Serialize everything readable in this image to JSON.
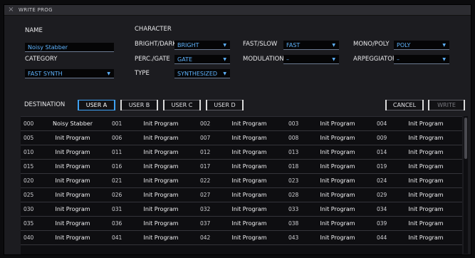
{
  "window": {
    "title": "WRITE PROG",
    "close_icon": "close-icon"
  },
  "labels": {
    "name": "NAME",
    "category": "CATEGORY",
    "character": "CHARACTER",
    "bright_dark": "BRIGHT/DARK",
    "perc_gate": "PERC./GATE",
    "type": "TYPE",
    "fast_slow": "FAST/SLOW",
    "modulation": "MODULATION",
    "mono_poly": "MONO/POLY",
    "arpeggiator": "ARPEGGIATOR",
    "destination": "DESTINATION"
  },
  "fields": {
    "name": "Noisy Stabber",
    "category": "FAST SYNTH",
    "bright_dark": "BRIGHT",
    "perc_gate": "GATE",
    "type": "SYNTHESIZED",
    "fast_slow": "FAST",
    "modulation": "–",
    "mono_poly": "POLY",
    "arpeggiator": "–",
    "dropdown_arrow": "▼"
  },
  "destination_buttons": [
    "USER A",
    "USER B",
    "USER C",
    "USER D"
  ],
  "active_destination": "USER A",
  "actions": {
    "cancel": "CANCEL",
    "write": "WRITE"
  },
  "programs": [
    [
      "000",
      "Noisy Stabber"
    ],
    [
      "001",
      "Init Program"
    ],
    [
      "002",
      "Init Program"
    ],
    [
      "003",
      "Init Program"
    ],
    [
      "004",
      "Init Program"
    ],
    [
      "005",
      "Init Program"
    ],
    [
      "006",
      "Init Program"
    ],
    [
      "007",
      "Init Program"
    ],
    [
      "008",
      "Init Program"
    ],
    [
      "009",
      "Init Program"
    ],
    [
      "010",
      "Init Program"
    ],
    [
      "011",
      "Init Program"
    ],
    [
      "012",
      "Init Program"
    ],
    [
      "013",
      "Init Program"
    ],
    [
      "014",
      "Init Program"
    ],
    [
      "015",
      "Init Program"
    ],
    [
      "016",
      "Init Program"
    ],
    [
      "017",
      "Init Program"
    ],
    [
      "018",
      "Init Program"
    ],
    [
      "019",
      "Init Program"
    ],
    [
      "020",
      "Init Program"
    ],
    [
      "021",
      "Init Program"
    ],
    [
      "022",
      "Init Program"
    ],
    [
      "023",
      "Init Program"
    ],
    [
      "024",
      "Init Program"
    ],
    [
      "025",
      "Init Program"
    ],
    [
      "026",
      "Init Program"
    ],
    [
      "027",
      "Init Program"
    ],
    [
      "028",
      "Init Program"
    ],
    [
      "029",
      "Init Program"
    ],
    [
      "030",
      "Init Program"
    ],
    [
      "031",
      "Init Program"
    ],
    [
      "032",
      "Init Program"
    ],
    [
      "033",
      "Init Program"
    ],
    [
      "034",
      "Init Program"
    ],
    [
      "035",
      "Init Program"
    ],
    [
      "036",
      "Init Program"
    ],
    [
      "037",
      "Init Program"
    ],
    [
      "038",
      "Init Program"
    ],
    [
      "039",
      "Init Program"
    ],
    [
      "040",
      "Init Program"
    ],
    [
      "041",
      "Init Program"
    ],
    [
      "042",
      "Init Program"
    ],
    [
      "043",
      "Init Program"
    ],
    [
      "044",
      "Init Program"
    ]
  ]
}
